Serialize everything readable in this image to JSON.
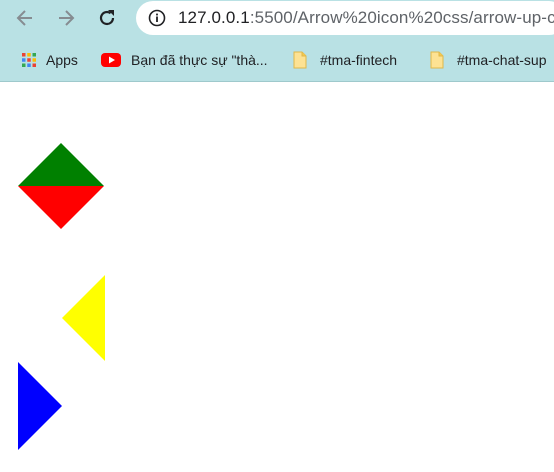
{
  "browser": {
    "url": {
      "host": "127.0.0.1",
      "path": ":5500/Arrow%20icon%20css/arrow-up-c"
    },
    "bookmarks": [
      {
        "label": "Apps",
        "icon": "apps-grid-icon"
      },
      {
        "label": "Bạn đã thực sự \"thà...",
        "icon": "youtube-icon"
      },
      {
        "label": "#tma-fintech",
        "icon": "bookmark-page-icon"
      },
      {
        "label": "#tma-chat-sup",
        "icon": "bookmark-page-icon"
      }
    ]
  },
  "page": {
    "shapes": [
      {
        "name": "diamond-top-half",
        "color": "#008000"
      },
      {
        "name": "diamond-bottom-half",
        "color": "#ff0000"
      },
      {
        "name": "arrow-left-triangle",
        "color": "#ffff00"
      },
      {
        "name": "arrow-right-triangle",
        "color": "#0000ff"
      }
    ]
  }
}
